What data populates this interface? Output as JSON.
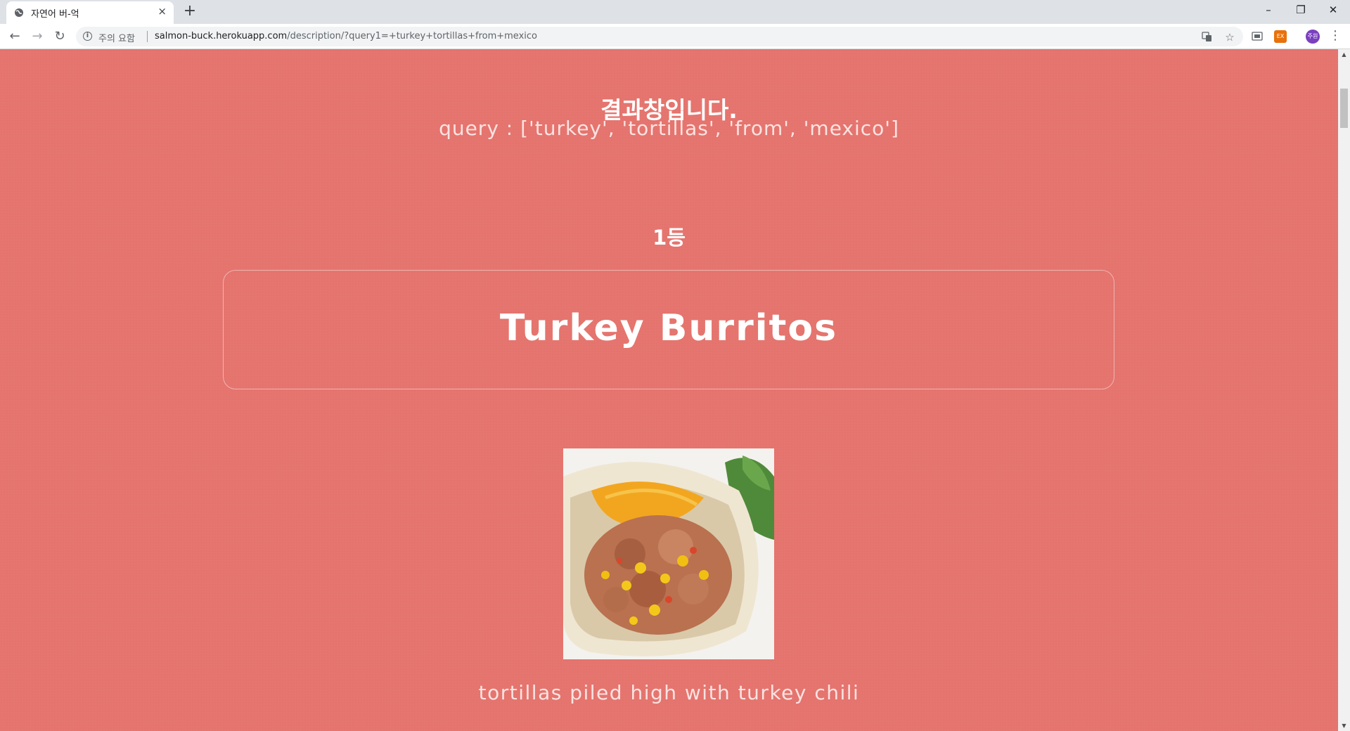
{
  "browser": {
    "tab_title": "자연어 버-억",
    "tab_close": "×",
    "new_tab": "+",
    "window_controls": {
      "minimize": "–",
      "restore": "❐",
      "close": "✕"
    },
    "nav": {
      "back": "←",
      "forward": "→",
      "reload": "↻"
    },
    "security_label": "주의 요함",
    "url_host": "salmon-buck.herokuapp.com",
    "url_path": "/description/?query1=+turkey+tortillas+from+mexico",
    "icons": [
      "translate-icon",
      "star-icon",
      "cast-icon",
      "extension-icon",
      "profile-avatar",
      "menu-icon"
    ],
    "profile_initials": "주원",
    "extension_label": "EX"
  },
  "page": {
    "title": "결과창입니다.",
    "query_text": "query : ['turkey', 'tortillas', 'from', 'mexico']",
    "rank_label": "1등",
    "result_name": "Turkey Burritos",
    "result_description": "tortillas piled high with turkey chili",
    "image_subject": "turkey burrito with corn and cheese"
  },
  "colors": {
    "page_background": "#e6756f",
    "text": "#ffffff",
    "tabstrip": "#dee1e6"
  }
}
